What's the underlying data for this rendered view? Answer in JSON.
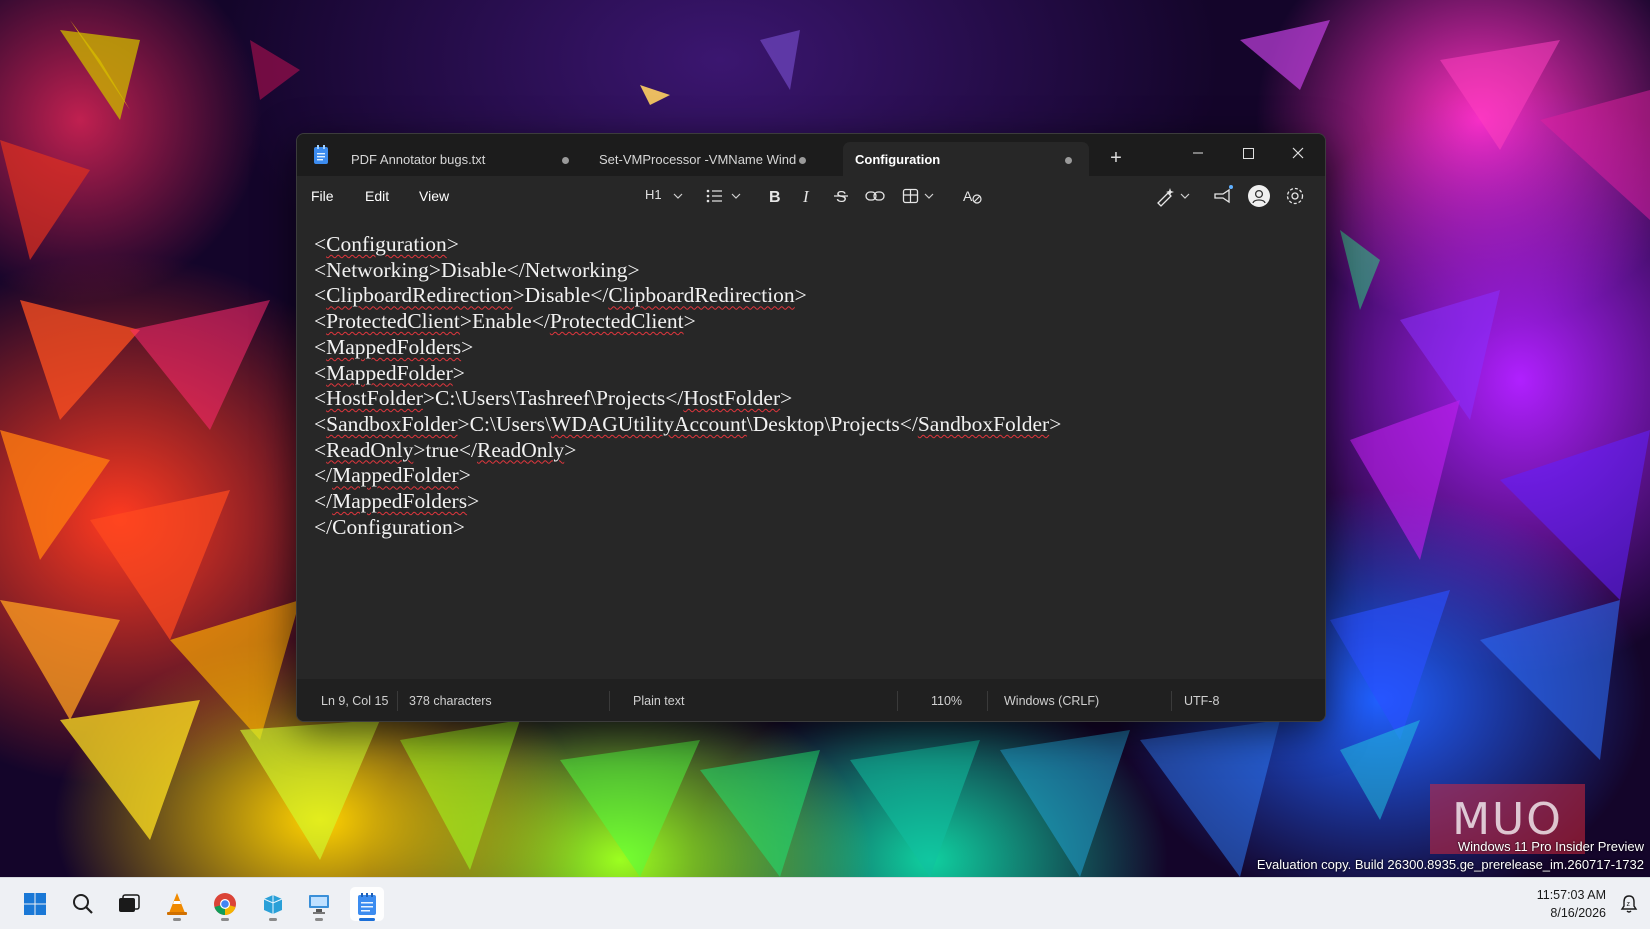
{
  "window": {
    "tabs": [
      {
        "label": "PDF Annotator bugs.txt"
      },
      {
        "label": "Set-VMProcessor -VMName Wind"
      },
      {
        "label": "Configuration"
      }
    ],
    "new_tab_label": "+"
  },
  "menu": {
    "file": "File",
    "edit": "Edit",
    "view": "View"
  },
  "toolbar": {
    "heading": "H1"
  },
  "editor": {
    "lines": [
      "<Configuration>",
      "<Networking>Disable</Networking>",
      "<ClipboardRedirection>Disable</ClipboardRedirection>",
      "<ProtectedClient>Enable</ProtectedClient>",
      "<MappedFolders>",
      "<MappedFolder>",
      "<HostFolder>C:\\Users\\Tashreef\\Projects</HostFolder>",
      "<SandboxFolder>C:\\Users\\WDAGUtilityAccount\\Desktop\\Projects</SandboxFolder>",
      "<ReadOnly>true</ReadOnly>",
      "</MappedFolder>",
      "</MappedFolders>",
      "</Configuration>"
    ]
  },
  "status": {
    "position": "Ln 9, Col 15",
    "characters": "378 characters",
    "format": "Plain text",
    "zoom": "110%",
    "line_ending": "Windows (CRLF)",
    "encoding": "UTF-8"
  },
  "watermark": {
    "logo": "MUO",
    "edition": "Windows 11 Pro Insider Preview",
    "build": "Evaluation copy. Build 26300.8935.ge_prerelease_im.260717-1732"
  },
  "taskbar": {
    "apps": [
      {
        "name": "Start",
        "icon": "windows-logo-icon"
      },
      {
        "name": "Search",
        "icon": "search-icon"
      },
      {
        "name": "Task View",
        "icon": "task-view-icon"
      },
      {
        "name": "VLC",
        "icon": "vlc-cone-icon"
      },
      {
        "name": "Chrome",
        "icon": "chrome-icon"
      },
      {
        "name": "Sandbox",
        "icon": "sandbox-icon"
      },
      {
        "name": "Remote Desktop",
        "icon": "remote-desktop-icon"
      },
      {
        "name": "Notepad",
        "icon": "notepad-icon"
      }
    ],
    "time": "11:57:03 AM",
    "date": "8/16/2026"
  },
  "colors": {
    "titlebar": "#1c1c1c",
    "editor_bg": "#272727",
    "statusbar": "#202020",
    "spell_underline": "#e0363d",
    "taskbar": "#eef0f4",
    "active_indicator": "#1b6fd8"
  }
}
